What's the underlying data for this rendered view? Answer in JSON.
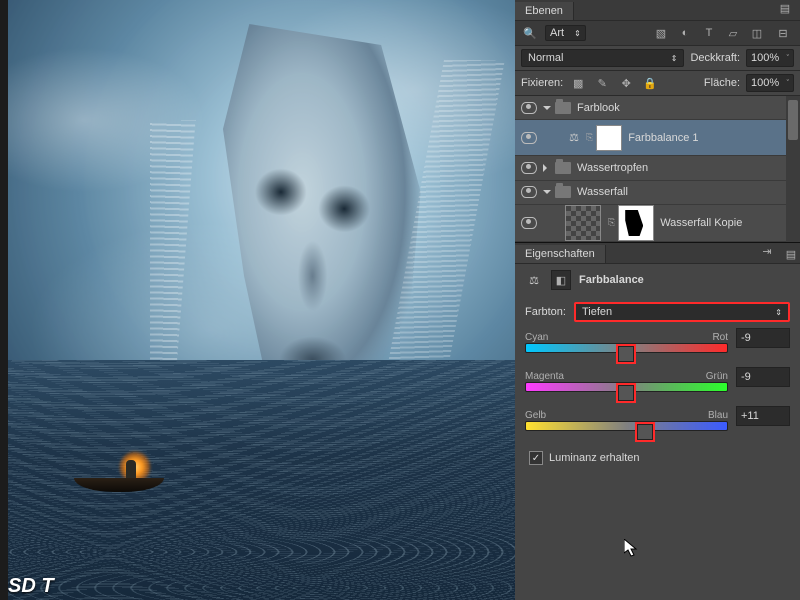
{
  "panels": {
    "layers_tab": "Ebenen",
    "properties_tab": "Eigenschaften",
    "filter_label": "Art",
    "blend_mode": "Normal",
    "opacity_label": "Deckkraft:",
    "opacity_value": "100%",
    "lock_label": "Fixieren:",
    "fill_label": "Fläche:",
    "fill_value": "100%"
  },
  "layers": [
    {
      "name": "Farblook",
      "type": "group",
      "expanded": true
    },
    {
      "name": "Farbbalance 1",
      "type": "adjustment",
      "selected": true
    },
    {
      "name": "Wassertropfen",
      "type": "group",
      "expanded": false
    },
    {
      "name": "Wasserfall",
      "type": "group",
      "expanded": true
    },
    {
      "name": "Wasserfall Kopie",
      "type": "layer"
    }
  ],
  "properties": {
    "title": "Farbbalance",
    "tone_label": "Farbton:",
    "tone_value": "Tiefen",
    "sliders": [
      {
        "left": "Cyan",
        "right": "Rot",
        "value": "-9",
        "pos": 46,
        "grad": "cr"
      },
      {
        "left": "Magenta",
        "right": "Grün",
        "value": "-9",
        "pos": 46,
        "grad": "mg"
      },
      {
        "left": "Gelb",
        "right": "Blau",
        "value": "+11",
        "pos": 55,
        "grad": "yb"
      }
    ],
    "preserve_lum": "Luminanz erhalten"
  },
  "watermark": "SD T"
}
